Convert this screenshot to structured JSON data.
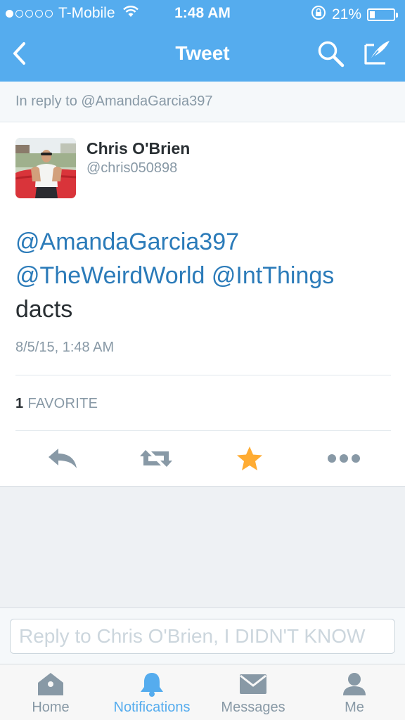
{
  "status_bar": {
    "carrier": "T-Mobile",
    "signal_bars": 1,
    "time": "1:48 AM",
    "battery": "21%",
    "battery_level": 0.21
  },
  "nav": {
    "title": "Tweet",
    "back_icon": "chevron-left-icon",
    "search_icon": "search-icon",
    "compose_icon": "compose-icon"
  },
  "reply_context": "In reply to @AmandaGarcia397",
  "tweet": {
    "author_name": "Chris O'Brien",
    "author_handle": "@chris050898",
    "mention_1": "@AmandaGarcia397",
    "mention_2": "@TheWeirdWorld",
    "mention_3": "@IntThings",
    "text": "dacts",
    "timestamp": "8/5/15, 1:48 AM",
    "favorite_count": "1",
    "favorite_label": "FAVORITE",
    "favorited": true
  },
  "actions": [
    {
      "name": "reply",
      "icon": "reply-icon"
    },
    {
      "name": "retweet",
      "icon": "retweet-icon"
    },
    {
      "name": "favorite",
      "icon": "star-icon"
    },
    {
      "name": "more",
      "icon": "more-icon"
    }
  ],
  "reply_box": {
    "placeholder": "Reply to Chris O'Brien, I DIDN'T KNOW"
  },
  "tabs": [
    {
      "label": "Home",
      "icon": "home-icon",
      "active": false
    },
    {
      "label": "Notifications",
      "icon": "bell-icon",
      "active": true
    },
    {
      "label": "Messages",
      "icon": "envelope-icon",
      "active": false
    },
    {
      "label": "Me",
      "icon": "person-icon",
      "active": false
    }
  ],
  "colors": {
    "brand": "#55acee",
    "link": "#2b7bb9",
    "favorite": "#ffac33",
    "muted": "#8899a6"
  }
}
